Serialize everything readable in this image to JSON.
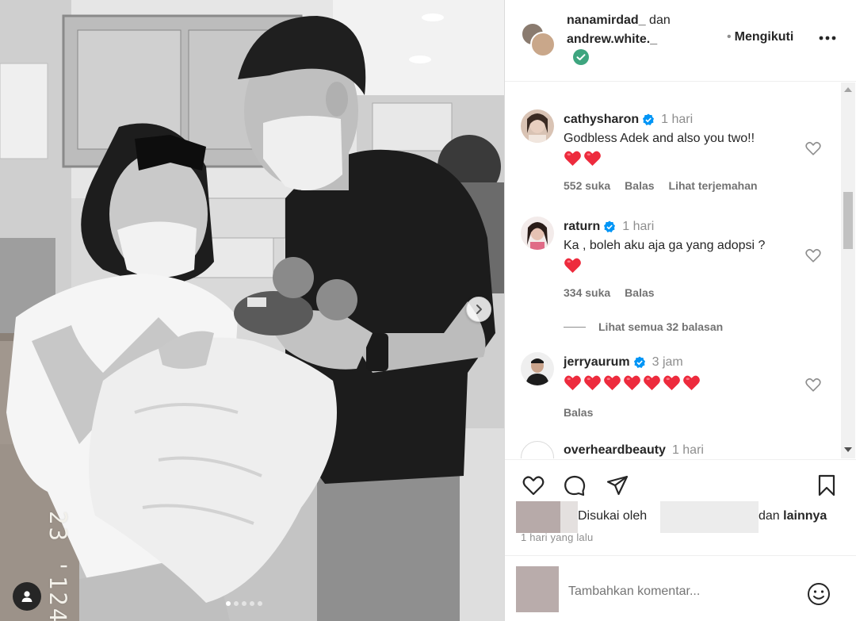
{
  "photo": {
    "date_stamp": "23 '124",
    "carousel": {
      "count": 5,
      "active": 0
    }
  },
  "header": {
    "user1": "nanamirdad_",
    "connector": "dan",
    "user2": "andrew.white._",
    "follow_separator": "•",
    "follow_label": "Mengikuti",
    "more_glyph": "•••"
  },
  "comments": [
    {
      "username": "cathysharon",
      "verified": true,
      "time": "1 hari",
      "text": "Godbless Adek and also you two!!",
      "hearts": 2,
      "likes": "552 suka",
      "reply": "Balas",
      "translate": "Lihat terjemahan"
    },
    {
      "username": "raturn",
      "verified": true,
      "time": "1 hari",
      "text": "Ka , boleh aku aja ga yang adopsi ?",
      "hearts": 1,
      "likes": "334 suka",
      "reply": "Balas",
      "view_replies": "Lihat semua 32 balasan"
    },
    {
      "username": "jerryaurum",
      "verified": true,
      "time": "3 jam",
      "hearts": 7,
      "reply": "Balas"
    },
    {
      "username": "overheardbeauty",
      "verified": false,
      "time": "1 hari"
    }
  ],
  "liked_by": {
    "prefix": "Disukai oleh",
    "and": "dan",
    "others": "lainnya"
  },
  "posted_ago": "1 hari yang lalu",
  "add_comment": {
    "placeholder": "Tambahkan komentar..."
  },
  "colors": {
    "heart_red": "#ed2b3d",
    "verified_blue": "#0095f6",
    "follow_check_green": "#3ea57f",
    "muted_text": "#737373"
  }
}
